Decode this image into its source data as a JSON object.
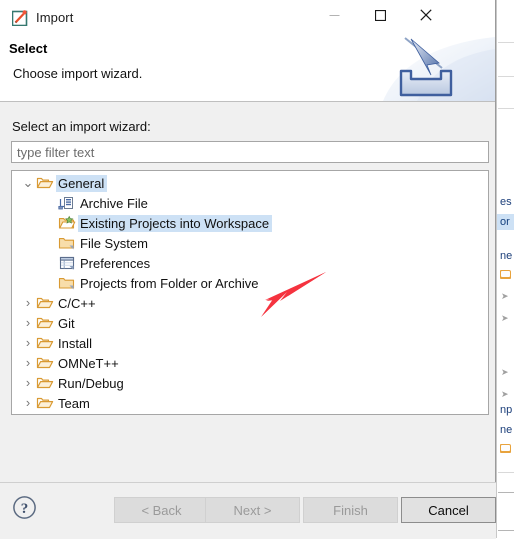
{
  "window": {
    "title": "Import",
    "icon": "import-wizard-icon",
    "controls": {
      "minimize": "minimize-icon",
      "maximize": "maximize-icon",
      "close": "close-icon"
    }
  },
  "banner": {
    "title": "Select",
    "subtitle": "Choose import wizard.",
    "graphic": "import-tray-arrow-icon"
  },
  "content": {
    "field_label": "Select an import wizard:",
    "filter": {
      "value": "",
      "placeholder": "type filter text"
    },
    "tree": [
      {
        "label": "General",
        "level": 0,
        "expanded": true,
        "selected": true,
        "icon": "folder-open-icon"
      },
      {
        "label": "Archive File",
        "level": 1,
        "expanded": null,
        "selected": false,
        "icon": "archive-file-icon"
      },
      {
        "label": "Existing Projects into Workspace",
        "level": 1,
        "expanded": null,
        "selected": true,
        "icon": "import-projects-icon"
      },
      {
        "label": "File System",
        "level": 1,
        "expanded": null,
        "selected": false,
        "icon": "folder-icon"
      },
      {
        "label": "Preferences",
        "level": 1,
        "expanded": null,
        "selected": false,
        "icon": "preferences-icon"
      },
      {
        "label": "Projects from Folder or Archive",
        "level": 1,
        "expanded": null,
        "selected": false,
        "icon": "folder-icon"
      },
      {
        "label": "C/C++",
        "level": 0,
        "expanded": false,
        "selected": false,
        "icon": "folder-open-icon"
      },
      {
        "label": "Git",
        "level": 0,
        "expanded": false,
        "selected": false,
        "icon": "folder-open-icon"
      },
      {
        "label": "Install",
        "level": 0,
        "expanded": false,
        "selected": false,
        "icon": "folder-open-icon"
      },
      {
        "label": "OMNeT++",
        "level": 0,
        "expanded": false,
        "selected": false,
        "icon": "folder-open-icon"
      },
      {
        "label": "Run/Debug",
        "level": 0,
        "expanded": false,
        "selected": false,
        "icon": "folder-open-icon"
      },
      {
        "label": "Team",
        "level": 0,
        "expanded": false,
        "selected": false,
        "icon": "folder-open-icon"
      }
    ]
  },
  "footer": {
    "help": "help-icon",
    "buttons": [
      {
        "label": "< Back",
        "enabled": false
      },
      {
        "label": "Next >",
        "enabled": false
      },
      {
        "label": "Finish",
        "enabled": false
      },
      {
        "label": "Cancel",
        "enabled": true
      }
    ]
  },
  "annotation": {
    "type": "red-arrow",
    "color": "#f5333f",
    "points_to": "Existing Projects into Workspace"
  },
  "background": {
    "visible_strip_texts": [
      "es",
      "or",
      "ne",
      "np",
      "ne"
    ]
  },
  "colors": {
    "selection": "#cde1f5",
    "folder": "#e8a33d",
    "banner_blue": "#3f5f9e",
    "annotation_red": "#f5333f",
    "dialog_bg": "#f0f0f0"
  }
}
